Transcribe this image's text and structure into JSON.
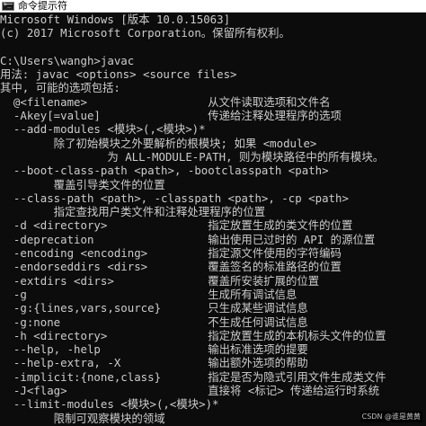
{
  "window": {
    "title": "命令提示符",
    "icon": "cmd-icon"
  },
  "console": {
    "lines": [
      "Microsoft Windows [版本 10.0.15063]",
      "(c) 2017 Microsoft Corporation。保留所有权利。",
      "",
      "C:\\Users\\wangh>javac",
      "用法: javac <options> <source files>",
      "其中, 可能的选项包括:",
      "  @<filename>                  从文件读取选项和文件名",
      "  -Akey[=value]                传递给注释处理程序的选项",
      "  --add-modules <模块>(,<模块>)*",
      "        除了初始模块之外要解析的根模块; 如果 <module>",
      "                为 ALL-MODULE-PATH, 则为模块路径中的所有模块。",
      "  --boot-class-path <path>, -bootclasspath <path>",
      "        覆盖引导类文件的位置",
      "  --class-path <path>, -classpath <path>, -cp <path>",
      "        指定查找用户类文件和注释处理程序的位置",
      "  -d <directory>               指定放置生成的类文件的位置",
      "  -deprecation                 输出使用已过时的 API 的源位置",
      "  -encoding <encoding>         指定源文件使用的字符编码",
      "  -endorseddirs <dirs>         覆盖签名的标准路径的位置",
      "  -extdirs <dirs>              覆盖所安装扩展的位置",
      "  -g                           生成所有调试信息",
      "  -g:{lines,vars,source}       只生成某些调试信息",
      "  -g:none                      不生成任何调试信息",
      "  -h <directory>               指定放置生成的本机标头文件的位置",
      "  --help, -help                输出标准选项的提要",
      "  --help-extra, -X             输出额外选项的帮助",
      "  -implicit:{none,class}       指定是否为隐式引用文件生成类文件",
      "  -J<flag>                     直接将 <标记> 传递给运行时系统",
      "  --limit-modules <模块>(,<模块>)*",
      "        限制可观察模块的领域"
    ]
  },
  "watermark": "CSDN @谁是黄黄"
}
